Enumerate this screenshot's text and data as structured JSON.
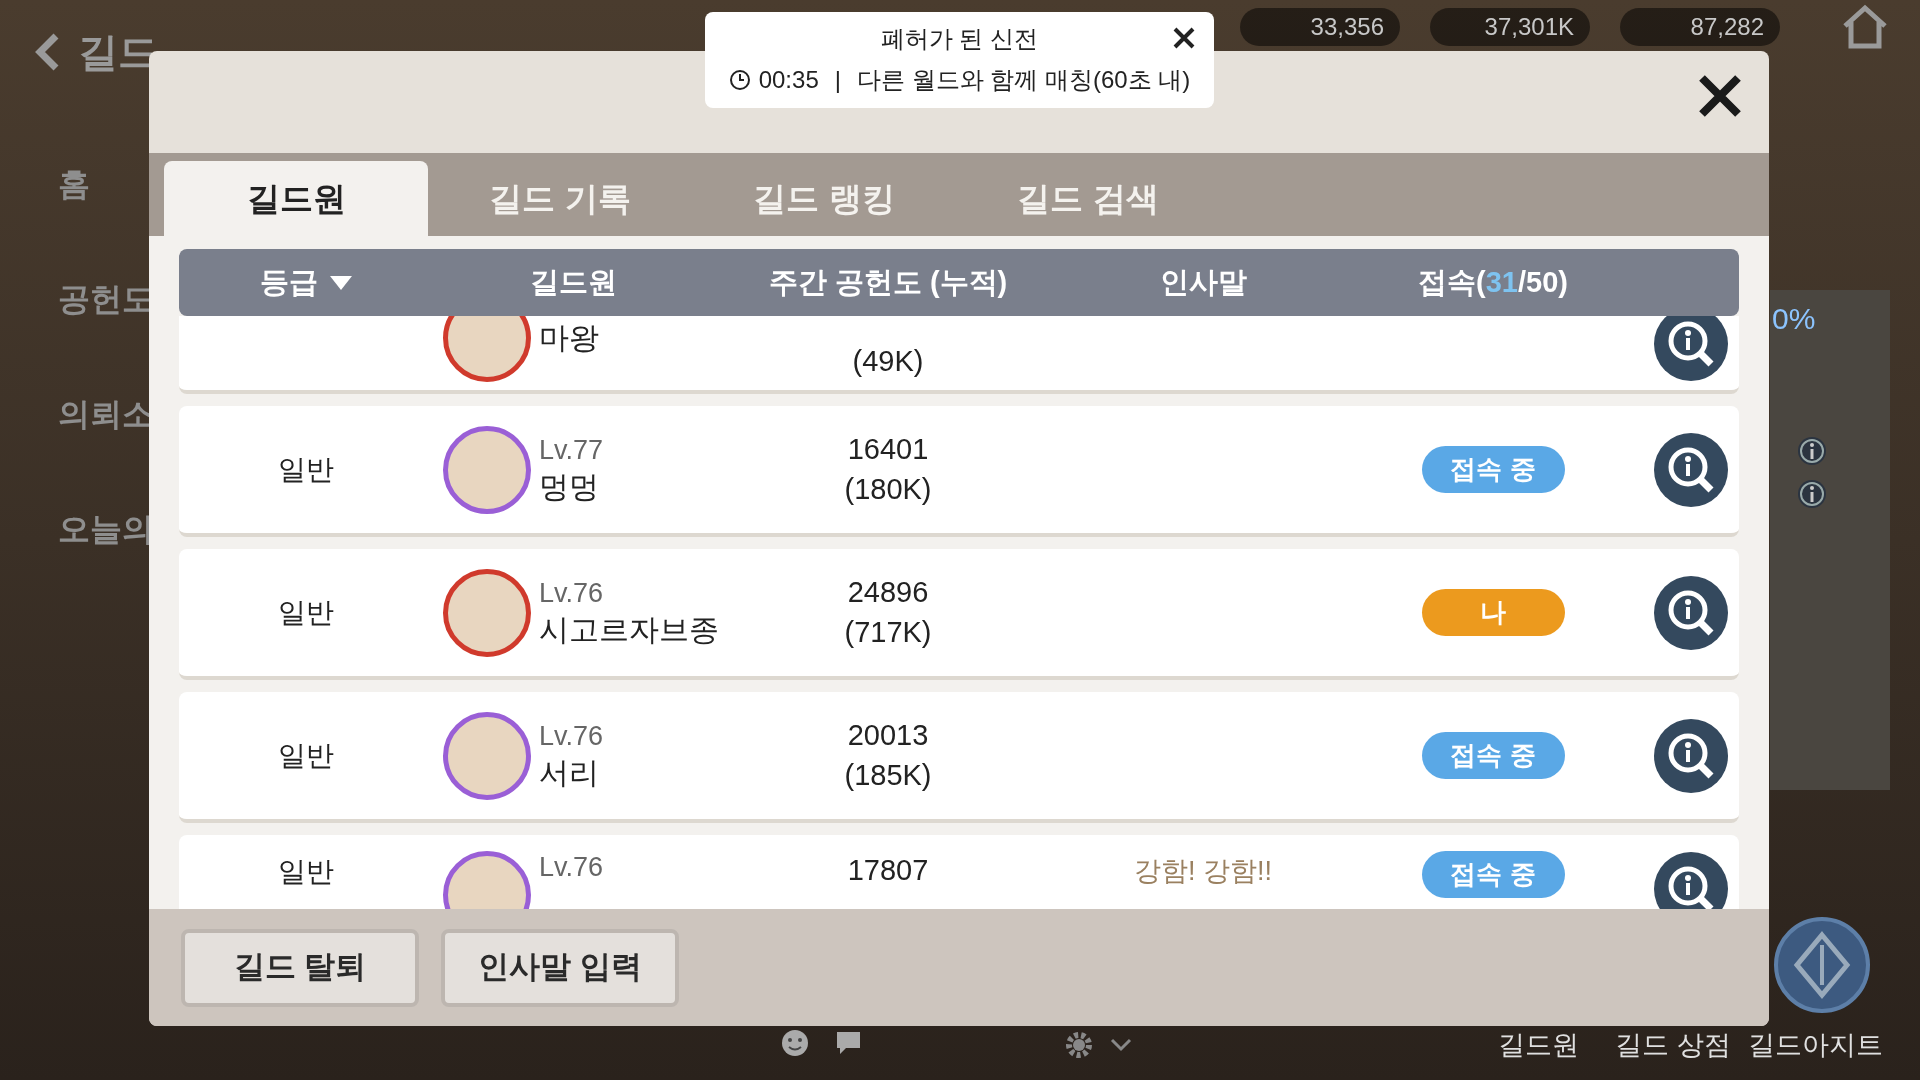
{
  "scene": {
    "back_label": "길드",
    "side_menu": [
      "홈",
      "공헌도",
      "의뢰소",
      "오늘의"
    ],
    "currencies": [
      "33,356",
      "37,301K",
      "87,282"
    ],
    "progress_text": "0%",
    "bottom_nav": [
      "길드원",
      "길드 상점",
      "길드아지트"
    ]
  },
  "notice": {
    "title": "폐허가 된 신전",
    "timer": "00:35",
    "separator": "|",
    "message": "다른 월드와 함께 매칭(60초 내)"
  },
  "tabs": [
    {
      "label": "길드원",
      "selected": true
    },
    {
      "label": "길드 기록",
      "selected": false
    },
    {
      "label": "길드 랭킹",
      "selected": false
    },
    {
      "label": "길드 검색",
      "selected": false
    }
  ],
  "columns": [
    {
      "label_parts": [
        {
          "text": "등급"
        }
      ],
      "sorted": true
    },
    {
      "label_parts": [
        {
          "text": "길드원"
        }
      ],
      "sorted": false
    },
    {
      "label_parts": [
        {
          "text": "주간 공헌도 (누적)"
        }
      ],
      "sorted": false
    },
    {
      "label_parts": [
        {
          "text": "인사말"
        }
      ],
      "sorted": false
    },
    {
      "label_parts": [
        {
          "text": "접속("
        },
        {
          "text": "31",
          "highlight": true
        },
        {
          "text": "/50)"
        }
      ],
      "sorted": false
    }
  ],
  "rows": [
    {
      "name": "마왕",
      "total": "(49K)",
      "color": "#d03a2c",
      "status": {
        "kind": "none"
      }
    },
    {
      "grade": "일반",
      "level": "Lv.77",
      "name": "멍멍",
      "weekly": "16401",
      "total": "(180K)",
      "color": "#9a5fd6",
      "status": {
        "kind": "online",
        "label": "접속 중"
      }
    },
    {
      "grade": "일반",
      "level": "Lv.76",
      "name": "시고르자브종",
      "weekly": "24896",
      "total": "(717K)",
      "color": "#d03a2c",
      "status": {
        "kind": "me",
        "label": "나"
      }
    },
    {
      "grade": "일반",
      "level": "Lv.76",
      "name": "서리",
      "weekly": "20013",
      "total": "(185K)",
      "color": "#9a5fd6",
      "status": {
        "kind": "online",
        "label": "접속 중"
      }
    },
    {
      "grade": "일반",
      "level": "Lv.76",
      "weekly": "17807",
      "greeting": "강함! 강함!!",
      "color": "#9a5fd6",
      "status": {
        "kind": "online",
        "label": "접속 중"
      }
    }
  ],
  "buttons": [
    "길드 탈퇴",
    "인사말 입력"
  ]
}
